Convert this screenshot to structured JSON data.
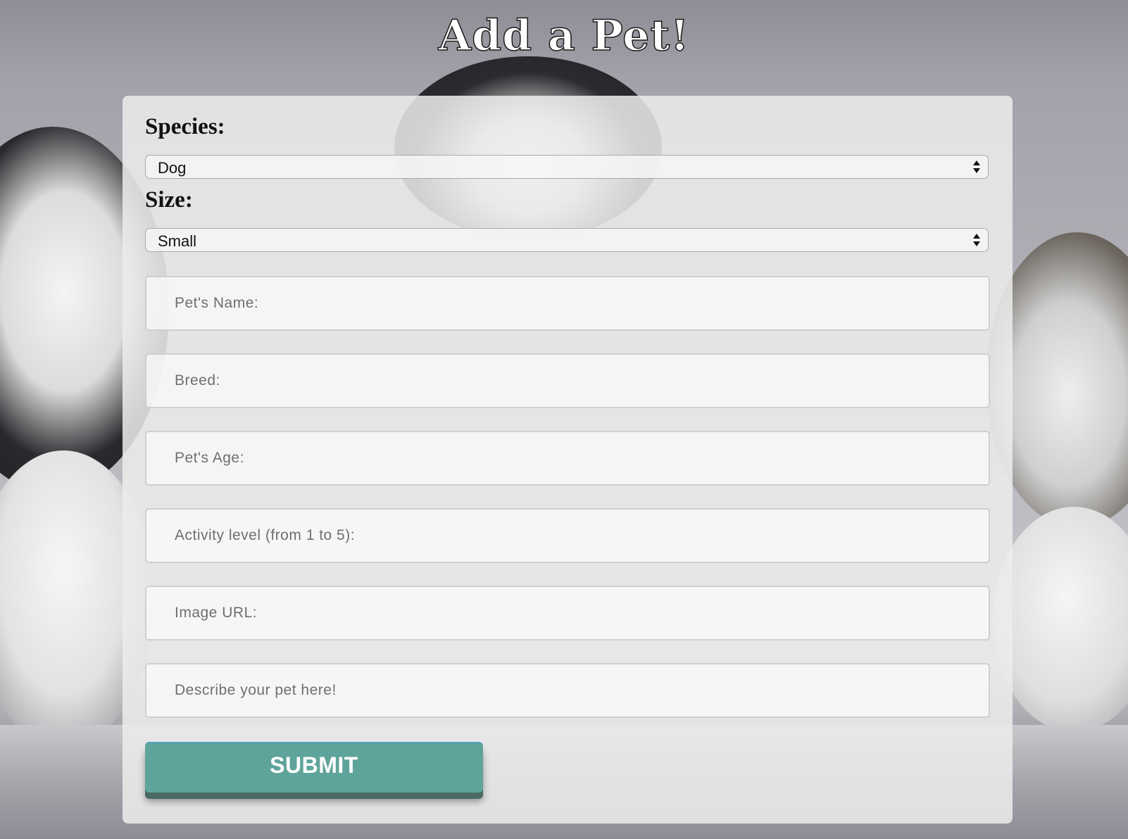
{
  "page": {
    "title": "Add a Pet!"
  },
  "form": {
    "species": {
      "label": "Species:",
      "selected": "Dog"
    },
    "size": {
      "label": "Size:",
      "selected": "Small"
    },
    "pet_name": {
      "placeholder": "Pet's Name:",
      "value": ""
    },
    "breed": {
      "placeholder": "Breed:",
      "value": ""
    },
    "pet_age": {
      "placeholder": "Pet's Age:",
      "value": ""
    },
    "activity_level": {
      "placeholder": "Activity level (from 1 to 5):",
      "value": ""
    },
    "image_url": {
      "placeholder": "Image URL:",
      "value": ""
    },
    "description": {
      "placeholder": "Describe your pet here!",
      "value": ""
    },
    "submit_label": "SUBMIT"
  },
  "colors": {
    "submit_button": "#5fa49a",
    "panel": "#ececec"
  },
  "icons": {
    "select_arrows": "updown-chevron-icon"
  }
}
